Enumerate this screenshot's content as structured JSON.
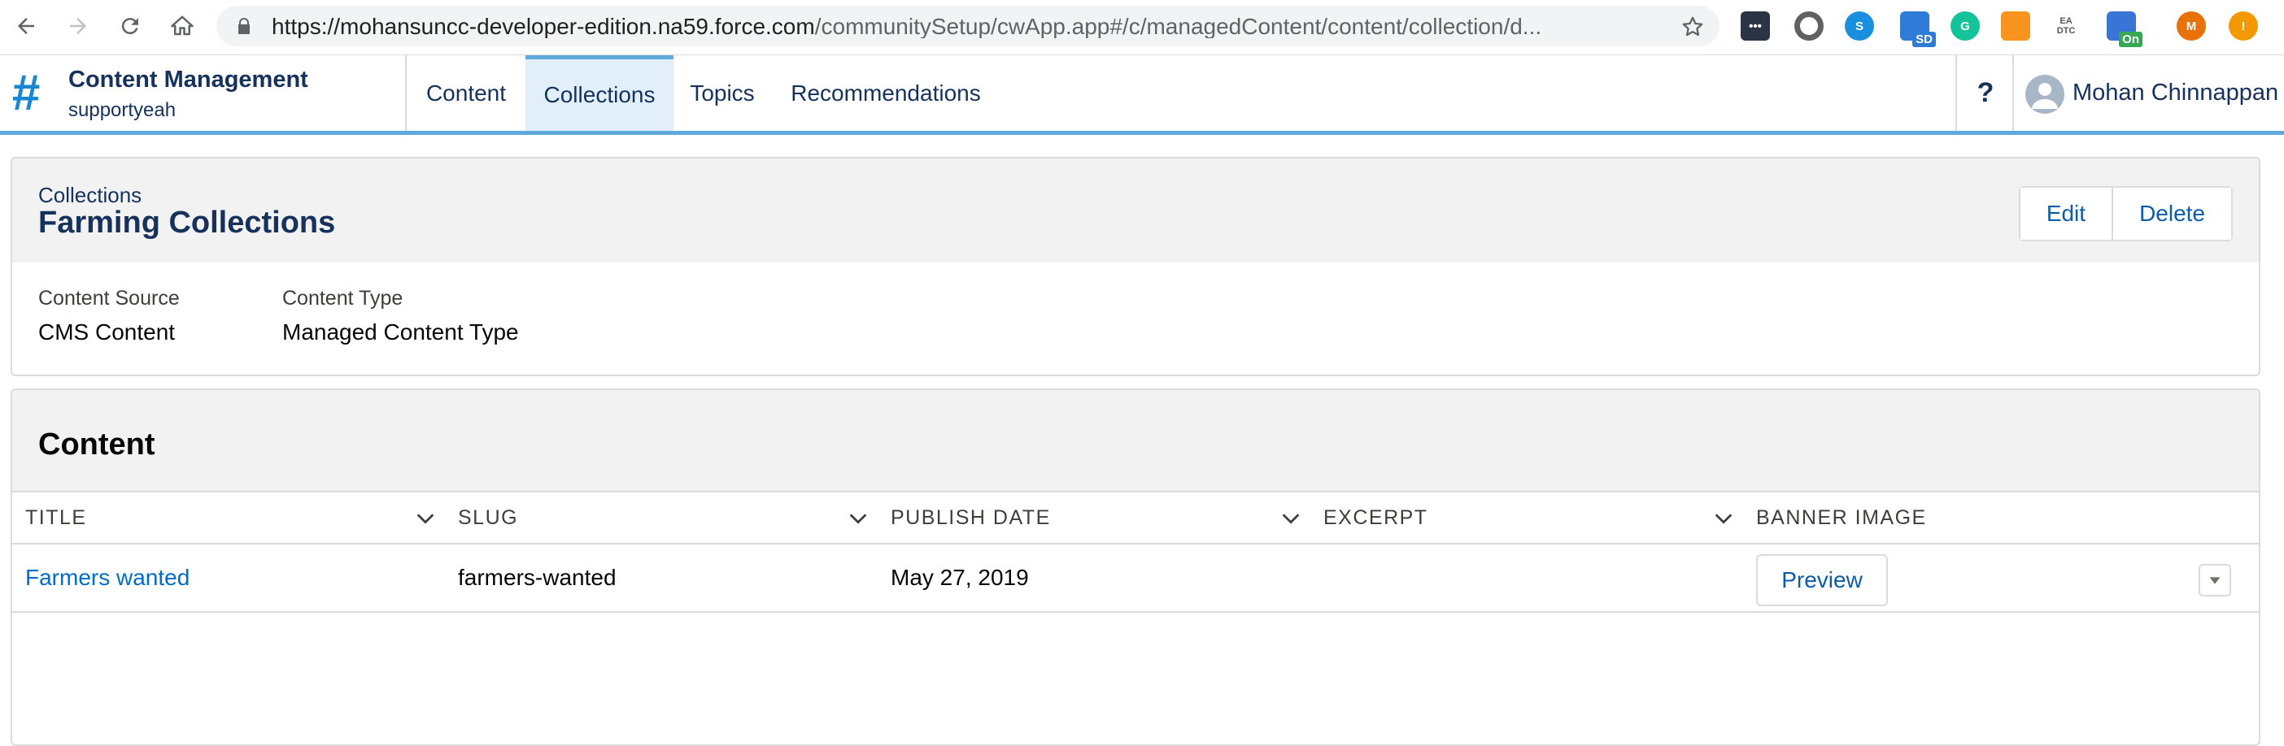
{
  "browser": {
    "url_host": "https://mohansuncc-developer-edition.na59.force.com",
    "url_path": "/communitySetup/cwApp.app#/c/managedContent/content/collection/d...",
    "extensions": [
      {
        "name": "dashlane-icon",
        "bg": "#2a3442",
        "label": "•••"
      },
      {
        "name": "circle-icon",
        "bg": "#ffffff",
        "label": ""
      },
      {
        "name": "skype-icon",
        "bg": "#1a8fe0",
        "label": "S"
      },
      {
        "name": "cloud-sd-icon",
        "bg": "#2f7bd8",
        "label": "",
        "badge": "SD"
      },
      {
        "name": "grammarly-icon",
        "bg": "#15c39a",
        "label": "G"
      },
      {
        "name": "orange-ext-icon",
        "bg": "#f7931e",
        "label": ""
      },
      {
        "name": "ea-dtc-icon",
        "bg": "#ffffff",
        "label": "EA DTC"
      },
      {
        "name": "on-ext-icon",
        "bg": "#3a74d6",
        "label": "",
        "badge": "On"
      },
      {
        "name": "profile-icon",
        "bg": "#e8710a",
        "label": "M"
      },
      {
        "name": "alert-icon",
        "bg": "#f29900",
        "label": "!"
      }
    ]
  },
  "app": {
    "title": "Content Management",
    "subtitle": "supportyeah",
    "tabs": [
      "Content",
      "Collections",
      "Topics",
      "Recommendations"
    ],
    "active_tab": "Collections",
    "help": "?",
    "user_name": "Mohan Chinnappan"
  },
  "record": {
    "breadcrumb": "Collections",
    "title": "Farming Collections",
    "edit_label": "Edit",
    "delete_label": "Delete",
    "fields": [
      {
        "label": "Content Source",
        "value": "CMS Content"
      },
      {
        "label": "Content Type",
        "value": "Managed Content Type"
      }
    ]
  },
  "content": {
    "heading": "Content",
    "columns": [
      "TITLE",
      "SLUG",
      "PUBLISH DATE",
      "EXCERPT",
      "BANNER IMAGE"
    ],
    "rows": [
      {
        "title": "Farmers wanted",
        "slug": "farmers-wanted",
        "publish_date": "May 27, 2019",
        "excerpt": "",
        "banner_button": "Preview"
      }
    ]
  },
  "colors": {
    "accent": "#5fa9dd",
    "link": "#006dcc",
    "brand": "#1b86d4",
    "text": "#16325c"
  }
}
